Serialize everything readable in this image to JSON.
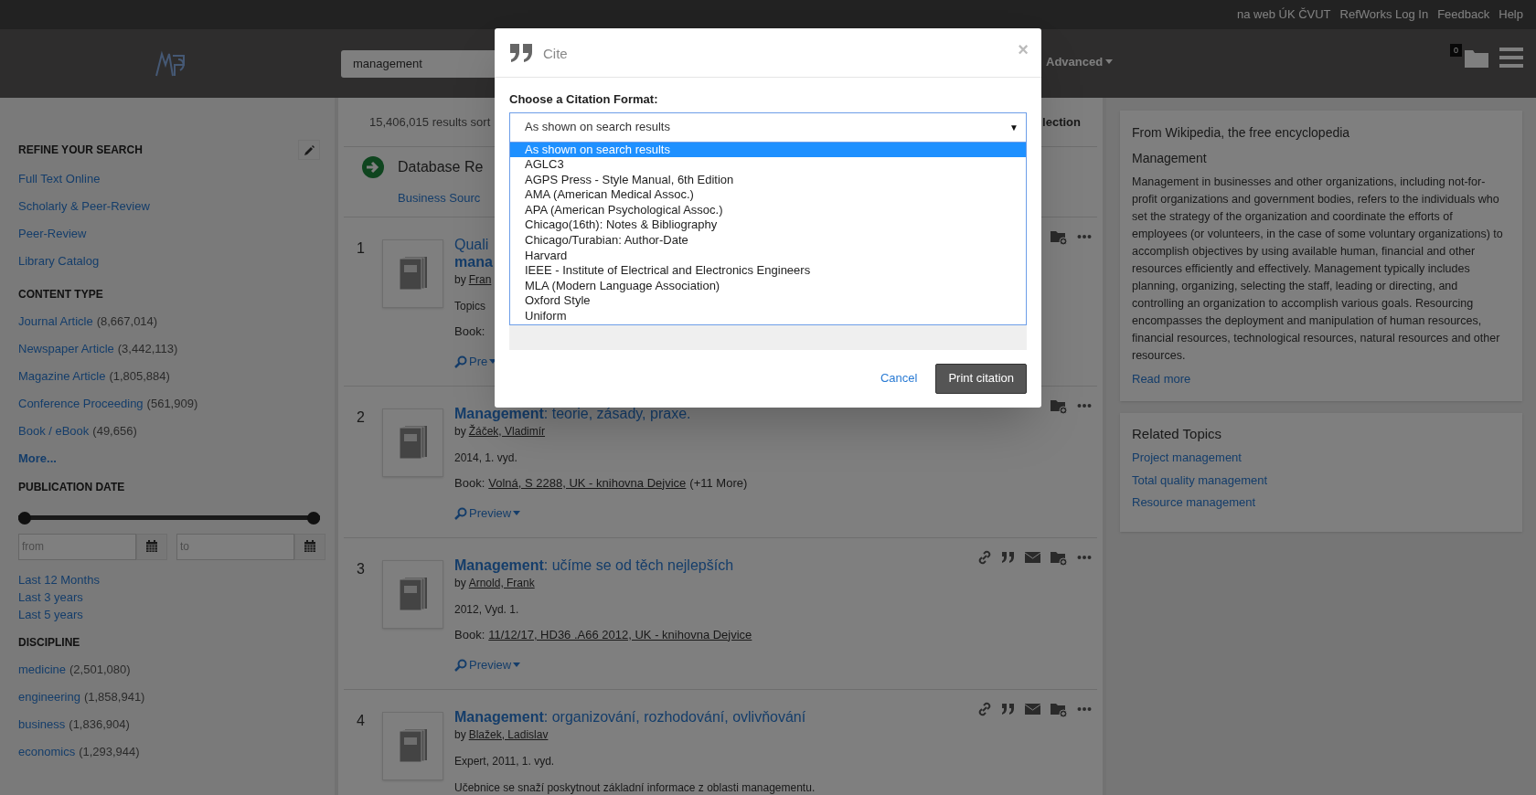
{
  "top_links": [
    "na web ÚK ČVUT",
    "RefWorks Log In",
    "Feedback",
    "Help"
  ],
  "header": {
    "search_value": "management",
    "advanced": "Advanced",
    "folder_count": "0"
  },
  "sidebar": {
    "sections": [
      {
        "title": "REFINE YOUR SEARCH",
        "kind": "links",
        "items": [
          {
            "label": "Full Text Online"
          },
          {
            "label": "Scholarly & Peer-Review"
          },
          {
            "label": "Peer-Review"
          },
          {
            "label": "Library Catalog"
          }
        ]
      },
      {
        "title": "CONTENT TYPE",
        "kind": "links",
        "items": [
          {
            "label": "Journal Article",
            "count": "(8,667,014)"
          },
          {
            "label": "Newspaper Article",
            "count": "(3,442,113)"
          },
          {
            "label": "Magazine Article",
            "count": "(1,805,884)"
          },
          {
            "label": "Conference Proceeding",
            "count": "(561,909)"
          },
          {
            "label": "Book / eBook",
            "count": "(49,656)"
          }
        ],
        "more": "More..."
      },
      {
        "title": "PUBLICATION DATE",
        "kind": "date",
        "level": 1,
        "from_placeholder": "from",
        "to_placeholder": "to",
        "items": [
          {
            "label": "Last 12 Months"
          },
          {
            "label": "Last 3 years"
          },
          {
            "label": "Last 5 years"
          }
        ]
      },
      {
        "title": "DISCIPLINE",
        "kind": "links",
        "items": [
          {
            "label": "medicine",
            "count": "(2,501,080)"
          },
          {
            "label": "engineering",
            "count": "(1,858,941)"
          },
          {
            "label": "business",
            "count": "(1,836,904)"
          },
          {
            "label": "economics",
            "count": "(1,293,944)"
          }
        ]
      }
    ]
  },
  "results_header": {
    "count": "15,406,015 results sort",
    "right": "lection"
  },
  "database": {
    "title": "Database Re",
    "link": "Business Sourc"
  },
  "results": [
    {
      "number": "1",
      "title_lines": [
        "Quali",
        "**mana**"
      ],
      "author_prefix": "by",
      "author": "Fran",
      "lines": [
        "Topics"
      ],
      "book": {
        "label": "Book:"
      },
      "preview": "Pre"
    },
    {
      "number": "2",
      "title_lines": [
        "**Management**: teorie, zásady, praxe."
      ],
      "author_prefix": "by",
      "author": "Žáček, Vladimír",
      "lines": [
        "2014, 1. vyd."
      ],
      "book": {
        "label": "Book:",
        "link": "Volná, S 2288, UK - knihovna Dejvice",
        "extra": "(+11 More)"
      },
      "preview": "Preview"
    },
    {
      "number": "3",
      "title_lines": [
        "**Management**: učíme se od těch nejlepších"
      ],
      "author_prefix": "by",
      "author": "Arnold, Frank",
      "lines": [
        "2012, Vyd. 1."
      ],
      "book": {
        "label": "Book:",
        "link": "11/12/17, HD36 .A66 2012, UK - knihovna Dejvice"
      },
      "preview": "Preview",
      "share_icons": true
    },
    {
      "number": "4",
      "title_lines": [
        "**Management**: organizování, rozhodování, ovlivňování"
      ],
      "author_prefix": "by",
      "author": "Blažek, Ladislav",
      "lines": [
        "Expert, 2011, 1. vyd.",
        "Učebnice se snaží poskytnout základní informace z oblasti managementu."
      ],
      "share_icons": true
    }
  ],
  "wikipedia": {
    "source": "From Wikipedia, the free encyclopedia",
    "title": "Management",
    "text": "Management in businesses and other organizations, including not-for-profit organizations and government bodies, refers to the individuals who set the strategy of the organization and coordinate the efforts of employees (or volunteers, in the case of some voluntary organizations) to accomplish objectives by using available human, financial and other resources efficiently and effectively. Management typically includes planning, organizing, selecting the staff, leading or directing, and controlling an organization to accomplish various goals. Resourcing encompasses the deployment and manipulation of human resources, financial resources, technological resources, natural resources and other resources.",
    "read_more": "Read more"
  },
  "related": {
    "title": "Related Topics",
    "items": [
      "Project management",
      "Total quality management",
      "Resource management"
    ]
  },
  "modal": {
    "title": "Cite",
    "close": "×",
    "label": "Choose a Citation Format:",
    "value": "As shown on search results",
    "caret": "▼",
    "options": [
      {
        "label": "As shown on search results",
        "selected": true
      },
      {
        "label": "AGLC3",
        "selected": false
      },
      {
        "label": "AGPS Press - Style Manual, 6th Edition",
        "selected": false
      },
      {
        "label": "AMA (American Medical Assoc.)",
        "selected": false
      },
      {
        "label": "APA (American Psychological Assoc.)",
        "selected": false
      },
      {
        "label": "Chicago(16th): Notes & Bibliography",
        "selected": false
      },
      {
        "label": "Chicago/Turabian: Author-Date",
        "selected": false
      },
      {
        "label": "Harvard",
        "selected": false
      },
      {
        "label": "IEEE - Institute of Electrical and Electronics Engineers",
        "selected": false
      },
      {
        "label": "MLA (Modern Language Association)",
        "selected": false
      },
      {
        "label": "Oxford Style",
        "selected": false
      },
      {
        "label": "Uniform",
        "selected": false
      }
    ],
    "cancel": "Cancel",
    "print": "Print citation"
  }
}
